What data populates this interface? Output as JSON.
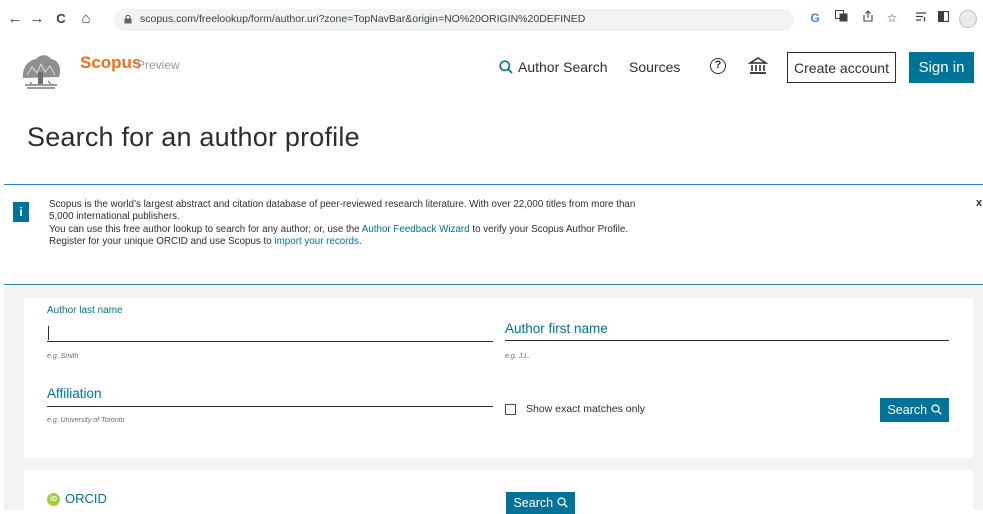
{
  "browser": {
    "url": "scopus.com/freelookup/form/author.uri?zone=TopNavBar&origin=NO%20ORIGIN%20DEFINED",
    "back_glyph": "←",
    "forward_glyph": "→",
    "reload_glyph": "C",
    "home_glyph": "⌂",
    "extensions": [
      "google-icon",
      "translate-icon",
      "share-icon",
      "bookmark-star-icon",
      "reading-list-icon",
      "split-view-icon",
      "profile-avatar-icon"
    ]
  },
  "header": {
    "brand": "Scopus",
    "brand_sub": "Preview",
    "author_search": "Author Search",
    "sources": "Sources",
    "help_glyph": "?",
    "create_account": "Create account",
    "sign_in": "Sign in"
  },
  "page": {
    "title": "Search for an author profile"
  },
  "banner": {
    "badge": "i",
    "line1": "Scopus is the world’s largest abstract and citation database of peer-reviewed research literature. With over 22,000 titles from more than 5,000 international publishers.",
    "line2_pre": "You can use this free author lookup to search for any author; or, use the ",
    "line2_link": "Author Feedback Wizard",
    "line2_post": " to verify your Scopus Author Profile.",
    "line3_pre": "Register for your unique ORCID and use Scopus to ",
    "line3_link": "import your records",
    "line3_post": ".",
    "close": "x"
  },
  "form": {
    "last_name_label": "Author last name",
    "last_name_value": "",
    "last_name_hint": "e.g. Smith",
    "first_name_label": "Author first name",
    "first_name_value": "",
    "first_name_hint": "e.g. J.L.",
    "affiliation_label": "Affiliation",
    "affiliation_value": "",
    "affiliation_hint": "e.g. University of Toronto",
    "exact_match_label": "Show exact matches only",
    "exact_match_checked": false,
    "search_button": "Search",
    "orcid_label": "ORCID",
    "orcid_badge": "iD",
    "orcid_search_button": "Search"
  },
  "colors": {
    "accent": "#007398",
    "brand": "#e9711c",
    "banner_border": "#2f82b7",
    "orcid": "#a6ce39"
  }
}
